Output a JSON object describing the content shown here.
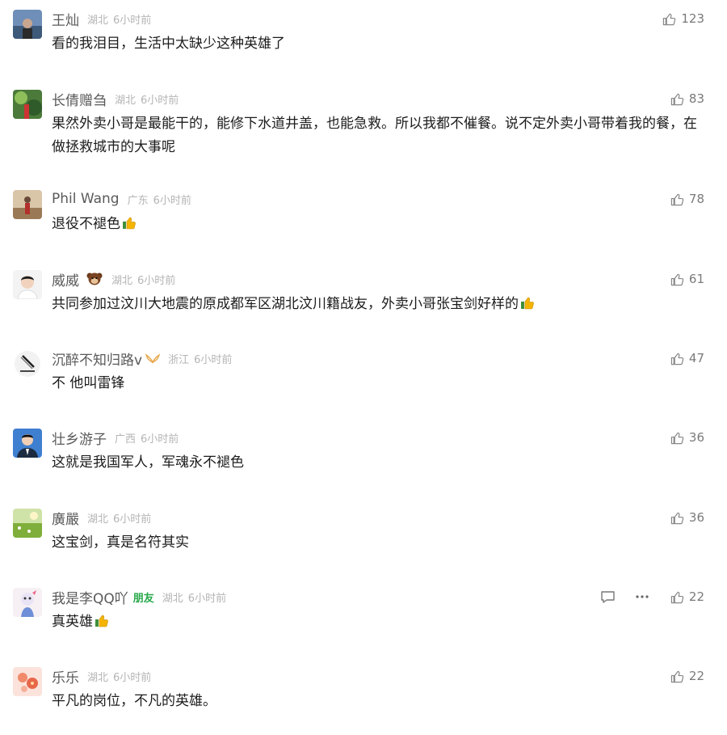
{
  "comments": [
    {
      "name": "王灿",
      "location": "湖北",
      "time": "6小时前",
      "text": "看的我泪目，生活中太缺少这种英雄了",
      "likes": "123",
      "avatar_icon": "avatar-lake-photo"
    },
    {
      "name": "长倩赠刍",
      "location": "湖北",
      "time": "6小时前",
      "text": "果然外卖小哥是最能干的，能修下水道井盖，也能急救。所以我都不催餐。说不定外卖小哥带着我的餐，在做拯救城市的大事呢",
      "likes": "83",
      "avatar_icon": "avatar-plants-photo"
    },
    {
      "name": "Phil Wang",
      "location": "广东",
      "time": "6小时前",
      "text": "退役不褪色",
      "likes": "78",
      "avatar_icon": "avatar-person-sunset",
      "emoji": "thumbs-up-emoji"
    },
    {
      "name": "威威",
      "location": "湖北",
      "time": "6小时前",
      "text": "共同参加过汶川大地震的原成都军区湖北汶川籍战友，外卖小哥张宝剑好样的",
      "likes": "61",
      "avatar_icon": "avatar-man-portrait",
      "emoji": "thumbs-up-emoji",
      "badge": "monkey-badge-icon"
    },
    {
      "name": "沉醉不知归路v",
      "location": "浙江",
      "time": "6小时前",
      "text": "不 他叫雷锋",
      "likes": "47",
      "avatar_icon": "avatar-logo-brush",
      "badge": "wing-badge-icon"
    },
    {
      "name": "壮乡游子",
      "location": "广西",
      "time": "6小时前",
      "text": "这就是我国军人，军魂永不褪色",
      "likes": "36",
      "avatar_icon": "avatar-id-photo"
    },
    {
      "name": "廣嚴",
      "location": "湖北",
      "time": "6小时前",
      "text": "这宝剑，真是名符其实",
      "likes": "36",
      "avatar_icon": "avatar-field-photo"
    },
    {
      "name": "我是李QQ吖",
      "tag": "朋友",
      "location": "湖北",
      "time": "6小时前",
      "text": "真英雄",
      "likes": "22",
      "avatar_icon": "avatar-cartoon",
      "emoji": "thumbs-up-emoji",
      "actions": [
        "reply-icon",
        "more-icon"
      ]
    },
    {
      "name": "乐乐",
      "location": "湖北",
      "time": "6小时前",
      "text": "平凡的岗位，不凡的英雄。",
      "likes": "22",
      "avatar_icon": "avatar-flowers-photo"
    }
  ],
  "colors": {
    "name": "#5a5a5a",
    "meta": "#b4b4b4",
    "friend": "#26a94a",
    "text": "#1c1c1c",
    "like": "#7a7a7a"
  }
}
